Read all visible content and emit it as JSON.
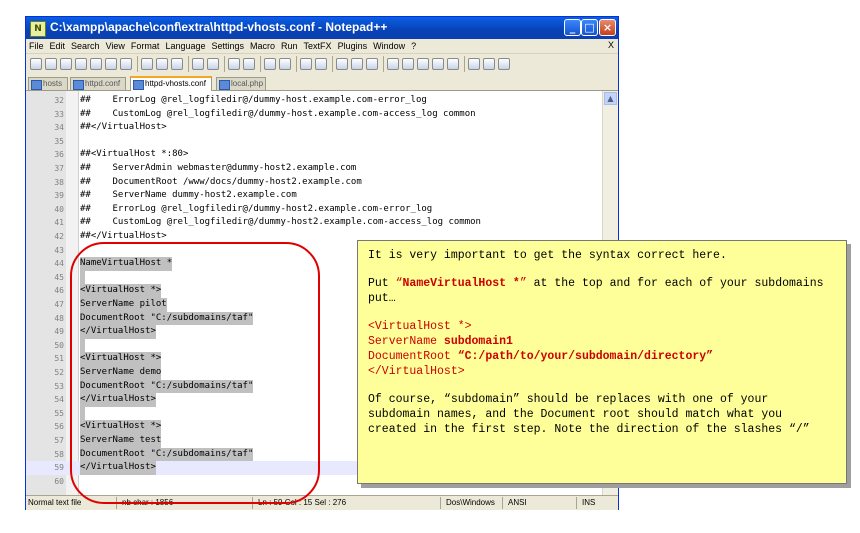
{
  "window": {
    "title": "C:\\xampp\\apache\\conf\\extra\\httpd-vhosts.conf - Notepad++",
    "app_icon": "notepad-plus-plus-icon",
    "controls": [
      "minimize",
      "maximize",
      "close"
    ]
  },
  "menubar": {
    "items": [
      "File",
      "Edit",
      "Search",
      "View",
      "Format",
      "Language",
      "Settings",
      "Macro",
      "Run",
      "TextFX",
      "Plugins",
      "Window",
      "?"
    ],
    "close_label": "X"
  },
  "tabs": [
    {
      "label": "hosts",
      "active": false
    },
    {
      "label": "httpd.conf",
      "active": false
    },
    {
      "label": "httpd-vhosts.conf",
      "active": true
    },
    {
      "label": "local.php",
      "active": false
    }
  ],
  "editor": {
    "lines": [
      {
        "num": "32",
        "text": "##    ErrorLog @rel_logfiledir@/dummy-host.example.com-error_log",
        "selected": false
      },
      {
        "num": "33",
        "text": "##    CustomLog @rel_logfiledir@/dummy-host.example.com-access_log common",
        "selected": false
      },
      {
        "num": "34",
        "text": "##</VirtualHost>",
        "selected": false
      },
      {
        "num": "35",
        "text": "",
        "selected": false
      },
      {
        "num": "36",
        "text": "##<VirtualHost *:80>",
        "selected": false
      },
      {
        "num": "37",
        "text": "##    ServerAdmin webmaster@dummy-host2.example.com",
        "selected": false
      },
      {
        "num": "38",
        "text": "##    DocumentRoot /www/docs/dummy-host2.example.com",
        "selected": false
      },
      {
        "num": "39",
        "text": "##    ServerName dummy-host2.example.com",
        "selected": false
      },
      {
        "num": "40",
        "text": "##    ErrorLog @rel_logfiledir@/dummy-host2.example.com-error_log",
        "selected": false
      },
      {
        "num": "41",
        "text": "##    CustomLog @rel_logfiledir@/dummy-host2.example.com-access_log common",
        "selected": false
      },
      {
        "num": "42",
        "text": "##</VirtualHost>",
        "selected": false
      },
      {
        "num": "43",
        "text": "",
        "selected": false
      },
      {
        "num": "44",
        "text": "NameVirtualHost *",
        "selected": true
      },
      {
        "num": "45",
        "text": " ",
        "selected": true
      },
      {
        "num": "46",
        "text": "<VirtualHost *>",
        "selected": true
      },
      {
        "num": "47",
        "text": "ServerName pilot",
        "selected": true
      },
      {
        "num": "48",
        "text": "DocumentRoot \"C:/subdomains/taf\"",
        "selected": true
      },
      {
        "num": "49",
        "text": "</VirtualHost>",
        "selected": true
      },
      {
        "num": "50",
        "text": " ",
        "selected": true
      },
      {
        "num": "51",
        "text": "<VirtualHost *>",
        "selected": true
      },
      {
        "num": "52",
        "text": "ServerName demo",
        "selected": true
      },
      {
        "num": "53",
        "text": "DocumentRoot \"C:/subdomains/taf\"",
        "selected": true
      },
      {
        "num": "54",
        "text": "</VirtualHost>",
        "selected": true
      },
      {
        "num": "55",
        "text": " ",
        "selected": true
      },
      {
        "num": "56",
        "text": "<VirtualHost *>",
        "selected": true
      },
      {
        "num": "57",
        "text": "ServerName test",
        "selected": true
      },
      {
        "num": "58",
        "text": "DocumentRoot \"C:/subdomains/taf\"",
        "selected": true
      },
      {
        "num": "59",
        "text": "</VirtualHost>",
        "selected": true
      },
      {
        "num": "60",
        "text": "",
        "selected": false
      }
    ]
  },
  "statusbar": {
    "type": "Normal text file",
    "nbchar": "nb char : 1856",
    "position": "Ln : 59    Col : 15    Sel : 276",
    "eol": "Dos\\Windows",
    "encoding": "ANSI",
    "mode": "INS"
  },
  "callout": {
    "p1": "It is very important to get the syntax correct here.",
    "p2a": "Put ",
    "p2q1": "“",
    "p2code": "NameVirtualHost *",
    "p2q2": "”",
    "p2b": " at the top and for each of your subdomains put…",
    "code1": "<VirtualHost *>",
    "code2a": "ServerName ",
    "code2b": "subdomain1",
    "code3a": "DocumentRoot ",
    "code3b": "“C:/path/to/your/subdomain/directory”",
    "code4": "</VirtualHost>",
    "p3": "Of course, “subdomain” should be replaces with one of your subdomain names, and the Document root should match what you created in the first step.  Note the direction of the slashes “/”"
  },
  "colors": {
    "annotation_red": "#e00000",
    "callout_bg": "#ffff99",
    "selection": "#c0c0c0",
    "titlebar": "#0842b5"
  }
}
